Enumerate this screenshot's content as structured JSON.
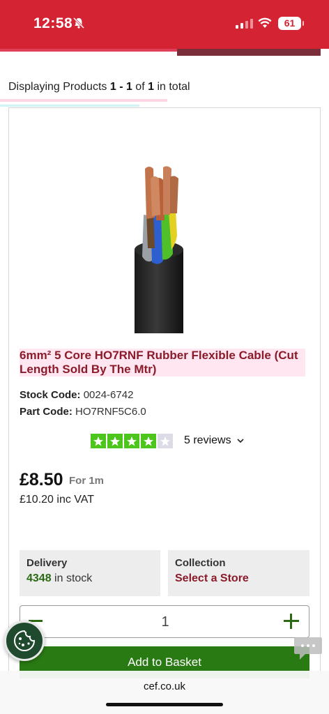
{
  "status_bar": {
    "time": "12:58",
    "battery": "61",
    "background": "#d42434"
  },
  "results": {
    "prefix": "Displaying Products ",
    "range": "1 - 1",
    "of_word": " of ",
    "total": "1",
    "suffix": " in total"
  },
  "product": {
    "title": "6mm² 5 Core HO7RNF Rubber Flexible Cable (Cut Length Sold By The Mtr)",
    "stock_code_label": "Stock Code:",
    "stock_code": "0024-6742",
    "part_code_label": "Part Code:",
    "part_code": "HO7RNF5C6.0",
    "rating_stars": 4,
    "rating_max": 5,
    "reviews_label": "5 reviews",
    "price": "£8.50",
    "price_unit": "For 1m",
    "price_inc_vat": "£10.20 inc VAT",
    "image_icon": "cable-icon"
  },
  "availability": {
    "delivery_heading": "Delivery",
    "stock_count": "4348",
    "stock_suffix": " in stock",
    "collection_heading": "Collection",
    "collection_action": "Select a Store"
  },
  "quantity": {
    "value": "1"
  },
  "actions": {
    "add_to_basket": "Add to Basket"
  },
  "browser": {
    "url": "cef.co.uk",
    "ghost_title": "6mm² 5 Core HO7RNF"
  },
  "colors": {
    "brand_red": "#d42434",
    "title_red": "#8b1b2a",
    "green": "#2a7a14",
    "star_green": "#4cc51d"
  }
}
